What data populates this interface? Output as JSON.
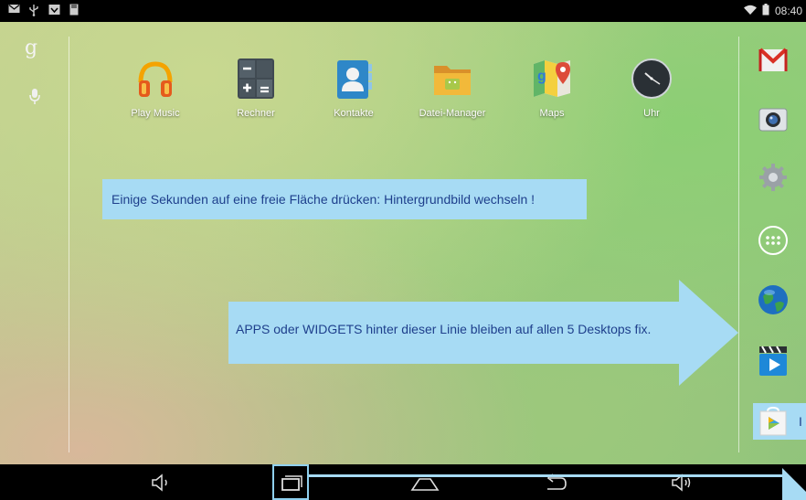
{
  "status_bar": {
    "left_icons": [
      "mail-icon",
      "usb-icon",
      "download-icon",
      "storage-icon"
    ],
    "wifi_icon": "wifi-icon",
    "battery_icon": "battery-icon",
    "time": "08:40"
  },
  "search": {
    "logo": "g",
    "mic_icon": "mic-icon"
  },
  "apps": [
    {
      "label": "Play Music",
      "icon": "headphones-icon"
    },
    {
      "label": "Rechner",
      "icon": "calculator-icon"
    },
    {
      "label": "Kontakte",
      "icon": "contacts-icon"
    },
    {
      "label": "Datei-Manager",
      "icon": "folder-icon"
    },
    {
      "label": "Maps",
      "icon": "maps-icon"
    },
    {
      "label": "Uhr",
      "icon": "clock-icon"
    }
  ],
  "annotations": {
    "wallpaper_tip": "Einige Sekunden auf eine freie Fläche drücken: Hintergrundbild wechseln !",
    "dock_tip": "APPS oder WIDGETS hinter dieser Linie bleiben auf allen 5 Desktops fix.",
    "store_tip": "I"
  },
  "dock": [
    "gmail-icon",
    "camera-icon",
    "settings-icon",
    "app-drawer-icon",
    "browser-icon",
    "video-icon",
    "play-store-icon"
  ],
  "navigation_bar": [
    "volume-down-icon",
    "recent-apps-icon",
    "home-icon",
    "back-icon",
    "volume-up-icon"
  ],
  "colors": {
    "annotation_bg": "#a7dbf4",
    "annotation_text": "#1e3f8c",
    "status_bar": "#000000"
  }
}
